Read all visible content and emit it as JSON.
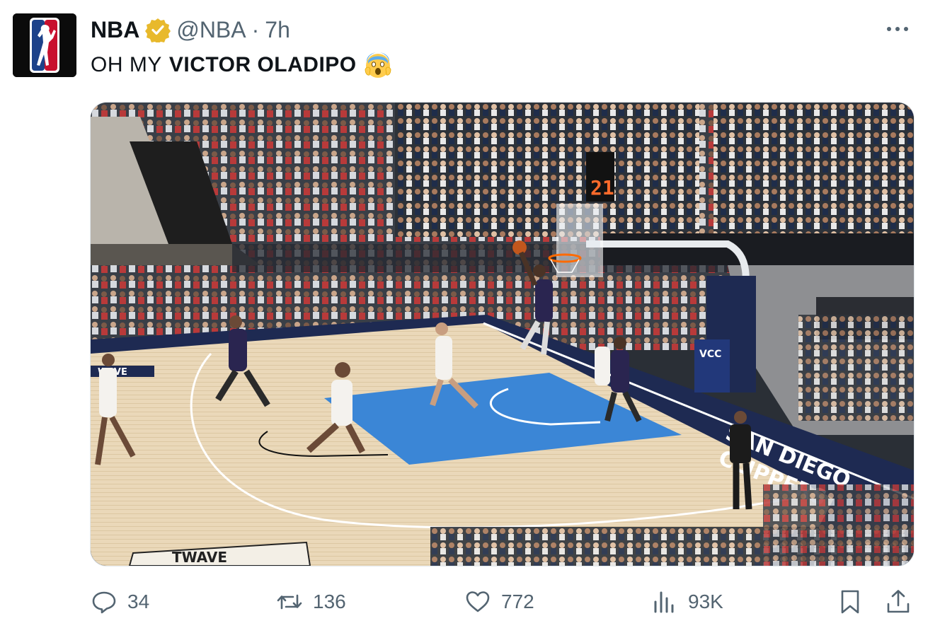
{
  "tweet": {
    "author_name": "NBA",
    "handle": "@NBA",
    "separator": "·",
    "time": "7h",
    "text_prefix": "OH MY",
    "text_bold": "VICTOR OLADIPO",
    "emoji": "screaming-face",
    "image_text": {
      "shot_clock": "21",
      "wave_sign": "TWAVE",
      "sideline": "WAVE",
      "baseline_logo": "VCC",
      "team_name_1": "SAN DIEGO",
      "team_name_2": "CLIPPERS"
    }
  },
  "actions": {
    "replies": "34",
    "retweets": "136",
    "likes": "772",
    "views": "93K"
  },
  "colors": {
    "accent_gold": "#e8b92c",
    "text_primary": "#0f1419",
    "text_secondary": "#536471",
    "court_blue": "#3b86d6",
    "court_wood": "#e9d6b6"
  },
  "icons": [
    "nba-logo-icon",
    "verified-badge-icon",
    "more-options-icon",
    "reply-icon",
    "retweet-icon",
    "like-icon",
    "views-icon",
    "bookmark-icon",
    "share-icon"
  ]
}
